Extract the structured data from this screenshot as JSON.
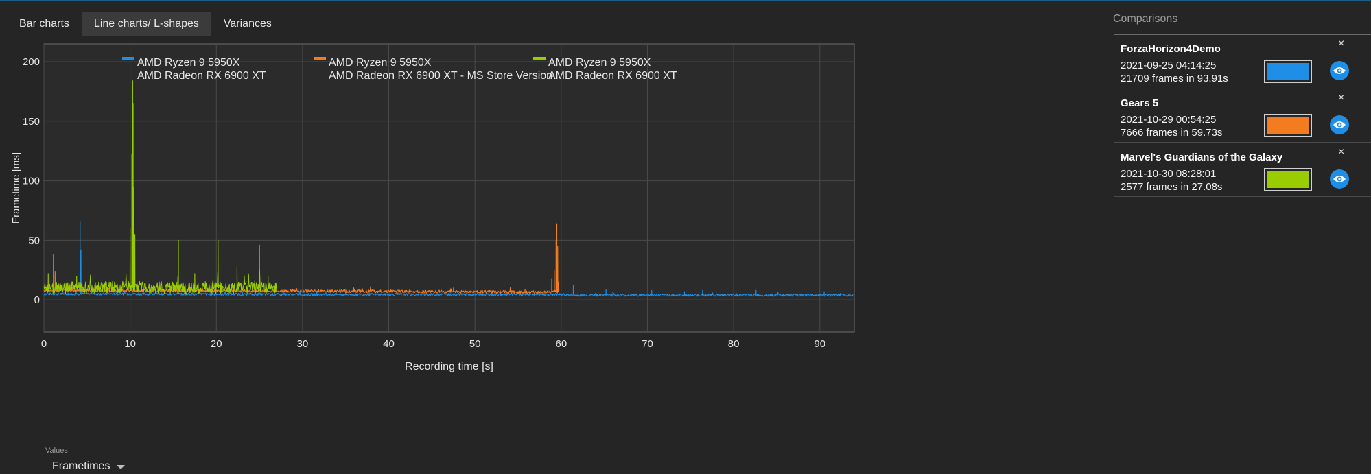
{
  "tabs": [
    {
      "label": "Bar charts",
      "active": false
    },
    {
      "label": "Line charts/ L-shapes",
      "active": true
    },
    {
      "label": "Variances",
      "active": false
    }
  ],
  "values_label": "Values",
  "metric_select": {
    "value": "Frametimes"
  },
  "comparisons": {
    "title": "Comparisons",
    "items": [
      {
        "name": "ForzaHorizon4Demo",
        "date": "2021-09-25 04:14:25",
        "frames": "21709 frames in 93.91s",
        "color": "#1e8ee6",
        "close": "×"
      },
      {
        "name": "Gears 5",
        "date": "2021-10-29 00:54:25",
        "frames": "7666 frames in 59.73s",
        "color": "#f47c20",
        "close": "×"
      },
      {
        "name": "Marvel's Guardians of the Galaxy",
        "date": "2021-10-30 08:28:01",
        "frames": "2577 frames in 27.08s",
        "color": "#9acd00",
        "close": "×"
      }
    ]
  },
  "chart_data": {
    "type": "line",
    "xlabel": "Recording time [s]",
    "ylabel": "Frametime [ms]",
    "xlim": [
      0,
      94
    ],
    "ylim": [
      -27,
      215
    ],
    "xticks": [
      0,
      10,
      20,
      30,
      40,
      50,
      60,
      70,
      80,
      90
    ],
    "yticks": [
      0,
      50,
      100,
      150,
      200
    ],
    "grid": true,
    "legend_position": "top",
    "series": [
      {
        "name": "AMD Ryzen 9 5950X\nAMD Radeon RX 6900 XT",
        "legend_lines": [
          "AMD Ryzen 9 5950X",
          "AMD Radeon RX 6900 XT"
        ],
        "color": "#1e8ee6",
        "duration": 93.91,
        "baseline": [
          [
            0,
            5.0
          ],
          [
            10,
            5.0
          ],
          [
            30,
            4.5
          ],
          [
            60,
            4.5
          ],
          [
            61,
            4.0
          ],
          [
            94,
            4.0
          ]
        ],
        "noise": 1.0,
        "spikes": [
          [
            4.2,
            66
          ],
          [
            4.3,
            42
          ],
          [
            8.5,
            9
          ],
          [
            15.5,
            9
          ],
          [
            29.5,
            10
          ],
          [
            35.0,
            7
          ],
          [
            61.4,
            12
          ],
          [
            65.2,
            9
          ],
          [
            66.0,
            7
          ],
          [
            70.5,
            8
          ],
          [
            74.3,
            7
          ],
          [
            76.4,
            8
          ],
          [
            82.6,
            8
          ],
          [
            90.5,
            7
          ]
        ]
      },
      {
        "name": "AMD Ryzen 9 5950X\nAMD Radeon RX 6900 XT - MS Store Version",
        "legend_lines": [
          "AMD Ryzen 9 5950X",
          "AMD Radeon RX 6900 XT - MS Store Version"
        ],
        "color": "#f47c20",
        "duration": 59.73,
        "baseline": [
          [
            0,
            8.0
          ],
          [
            26,
            7.5
          ],
          [
            30,
            7.5
          ],
          [
            45,
            7.0
          ],
          [
            57,
            6.5
          ],
          [
            59.3,
            7.0
          ]
        ],
        "noise": 1.2,
        "spikes": [
          [
            0.6,
            20
          ],
          [
            1.1,
            38
          ],
          [
            1.3,
            24
          ],
          [
            3.0,
            12
          ],
          [
            10.2,
            15
          ],
          [
            22.0,
            12
          ],
          [
            36.0,
            9
          ],
          [
            47.5,
            10
          ],
          [
            55.8,
            9
          ],
          [
            58.9,
            18
          ],
          [
            59.2,
            25
          ],
          [
            59.4,
            50
          ],
          [
            59.5,
            64
          ],
          [
            59.6,
            45
          ],
          [
            59.7,
            15
          ]
        ]
      },
      {
        "name": "AMD Ryzen 9 5950X\nAMD Radeon RX 6900 XT",
        "legend_lines": [
          "AMD Ryzen 9 5950X",
          "AMD Radeon RX 6900 XT"
        ],
        "color": "#9acd00",
        "duration": 27.08,
        "baseline": [
          [
            0,
            10.0
          ],
          [
            10,
            11.0
          ],
          [
            15,
            10.0
          ],
          [
            27.08,
            10.0
          ]
        ],
        "noise": 5.0,
        "spikes": [
          [
            0.5,
            22
          ],
          [
            3.8,
            20
          ],
          [
            10.0,
            60
          ],
          [
            10.2,
            122
          ],
          [
            10.3,
            184
          ],
          [
            10.35,
            165
          ],
          [
            10.45,
            95
          ],
          [
            10.55,
            55
          ],
          [
            15.6,
            50
          ],
          [
            17.5,
            22
          ],
          [
            20.2,
            50
          ],
          [
            22.4,
            28
          ],
          [
            25.0,
            46
          ],
          [
            26.0,
            20
          ]
        ]
      }
    ]
  }
}
